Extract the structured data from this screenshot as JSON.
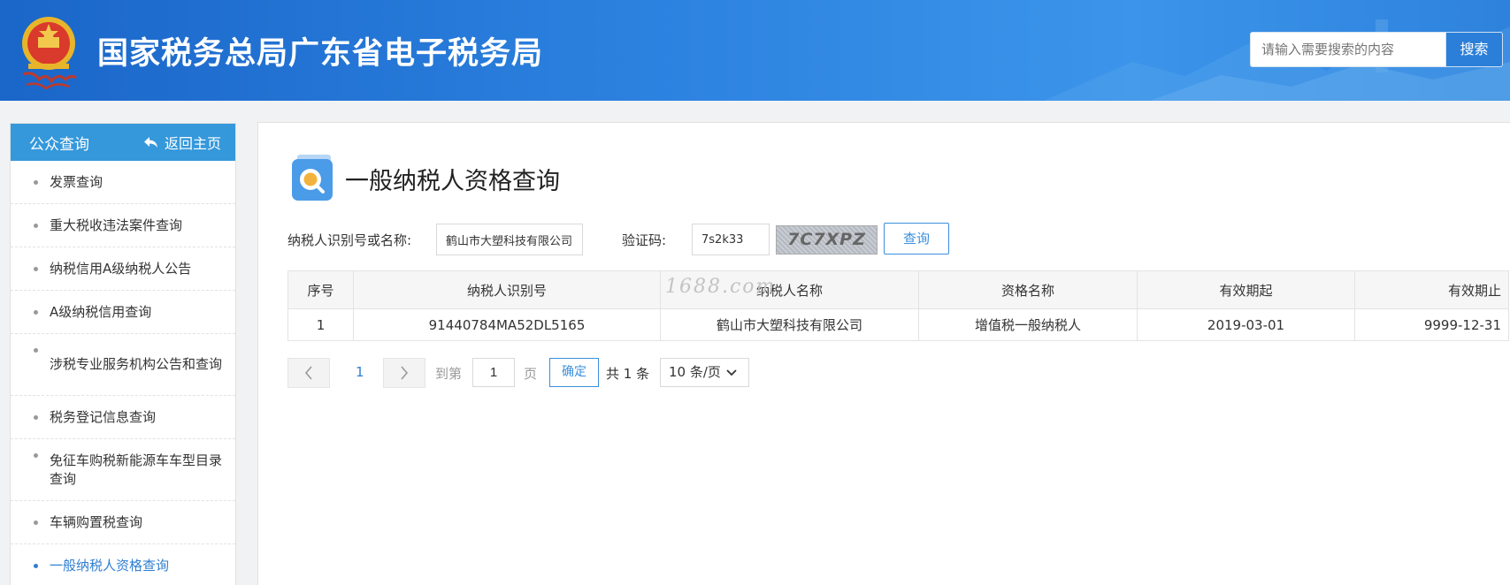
{
  "header": {
    "site_title": "国家税务总局广东省电子税务局",
    "search_placeholder": "请输入需要搜索的内容",
    "search_button": "搜索",
    "emblem_icon": "national-emblem-icon"
  },
  "sidebar": {
    "title": "公众查询",
    "back_label": "返回主页",
    "items": [
      {
        "label": "发票查询",
        "active": false
      },
      {
        "label": "重大税收违法案件查询",
        "active": false
      },
      {
        "label": "纳税信用A级纳税人公告",
        "active": false
      },
      {
        "label": "A级纳税信用查询",
        "active": false
      },
      {
        "label": "涉税专业服务机构公告和查询",
        "active": false
      },
      {
        "label": "税务登记信息查询",
        "active": false
      },
      {
        "label": "免征车购税新能源车车型目录查询",
        "active": false
      },
      {
        "label": "车辆购置税查询",
        "active": false
      },
      {
        "label": "一般纳税人资格查询",
        "active": true
      }
    ]
  },
  "main": {
    "page_title": "一般纳税人资格查询",
    "page_icon": "search-document-icon",
    "form": {
      "taxpayer_label": "纳税人识别号或名称:",
      "taxpayer_value": "鹤山市大塑科技有限公司",
      "captcha_label": "验证码:",
      "captcha_value": "7s2k33",
      "captcha_image_text": "7C7XPZ",
      "query_button": "查询"
    },
    "table": {
      "columns": [
        "序号",
        "纳税人识别号",
        "纳税人名称",
        "资格名称",
        "有效期起",
        "有效期止"
      ],
      "rows": [
        [
          "1",
          "91440784MA52DL5165",
          "鹤山市大塑科技有限公司",
          "增值税一般纳税人",
          "2019-03-01",
          "9999-12-31"
        ]
      ]
    },
    "watermark": "1688.com",
    "pagination": {
      "prev_icon": "chevron-left-icon",
      "next_icon": "chevron-right-icon",
      "current_page": "1",
      "goto_prefix": "到第",
      "goto_value": "1",
      "goto_suffix": "页",
      "confirm": "确定",
      "total": "共 1 条",
      "page_size": "10 条/页"
    }
  },
  "colors": {
    "header_blue": "#2d83e0",
    "sidebar_head": "#3598db",
    "accent": "#2f7fd1"
  }
}
